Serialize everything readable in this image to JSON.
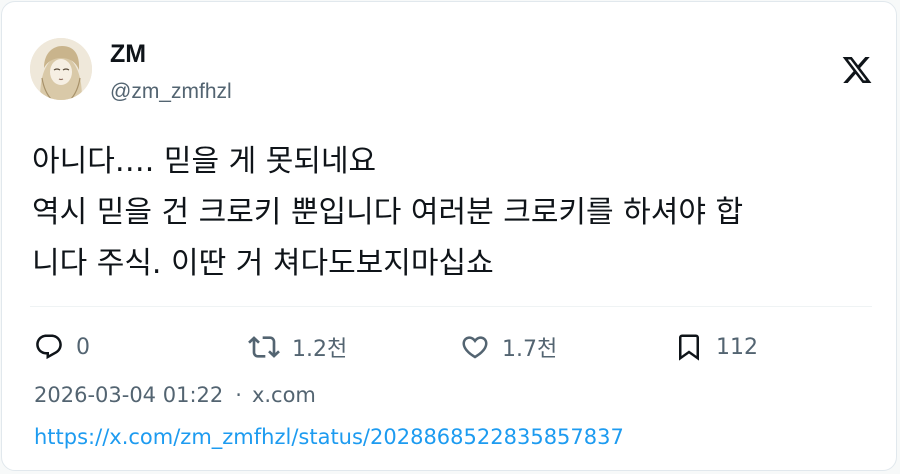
{
  "author": {
    "display_name": "ZM",
    "handle": "@zm_zmfhzl"
  },
  "tweet": {
    "lines": [
      "아니다…. 믿을 게 못되네요",
      "역시 믿을 건 크로키 뿐입니다 여러분 크로키를 하셔야 합",
      "니다 주식. 이딴 거 쳐다도보지마십쇼"
    ]
  },
  "actions": {
    "replies": "0",
    "retweets": "1.2천",
    "likes": "1.7천",
    "bookmarks": "112"
  },
  "meta": {
    "timestamp": "2026-03-04 01:22",
    "separator": "·",
    "source": "x.com"
  },
  "url": "https://x.com/zm_zmfhzl/status/2028868522835857837",
  "icons": {
    "logo": "x-logo-icon",
    "reply": "reply-icon",
    "retweet": "retweet-icon",
    "like": "heart-icon",
    "bookmark": "bookmark-icon"
  },
  "colors": {
    "text": "#0f1419",
    "secondary": "#536471",
    "link": "#1d9bf0",
    "border": "#e1e8ed"
  }
}
